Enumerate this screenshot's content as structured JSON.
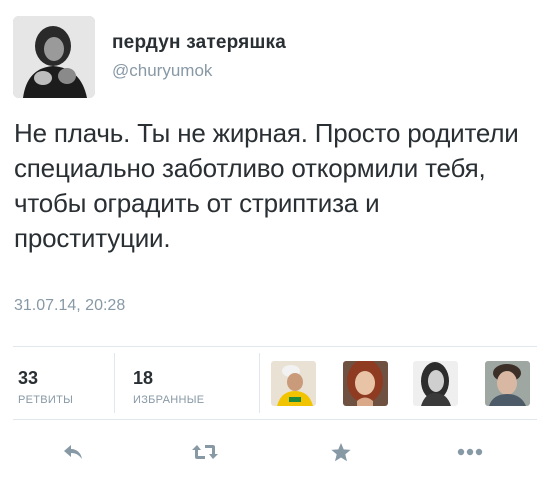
{
  "author": {
    "display_name": "пердун затеряшка",
    "handle": "@churyumok"
  },
  "tweet": {
    "text": "Не плачь. Ты не жирная. Просто родители специально заботливо откормили тебя, чтобы оградить от стриптиза и проституции.",
    "timestamp": "31.07.14, 20:28"
  },
  "stats": {
    "retweets_count": "33",
    "retweets_label": "РЕТВИТЫ",
    "favorites_count": "18",
    "favorites_label": "ИЗБРАННЫЕ"
  },
  "actions": {
    "reply_icon": "reply-icon",
    "retweet_icon": "retweet-icon",
    "favorite_icon": "star-icon",
    "more_icon": "more-icon"
  },
  "colors": {
    "text": "#292f33",
    "secondary": "#8899a6",
    "divider": "#e1e8ed",
    "icon": "#8899a6"
  }
}
